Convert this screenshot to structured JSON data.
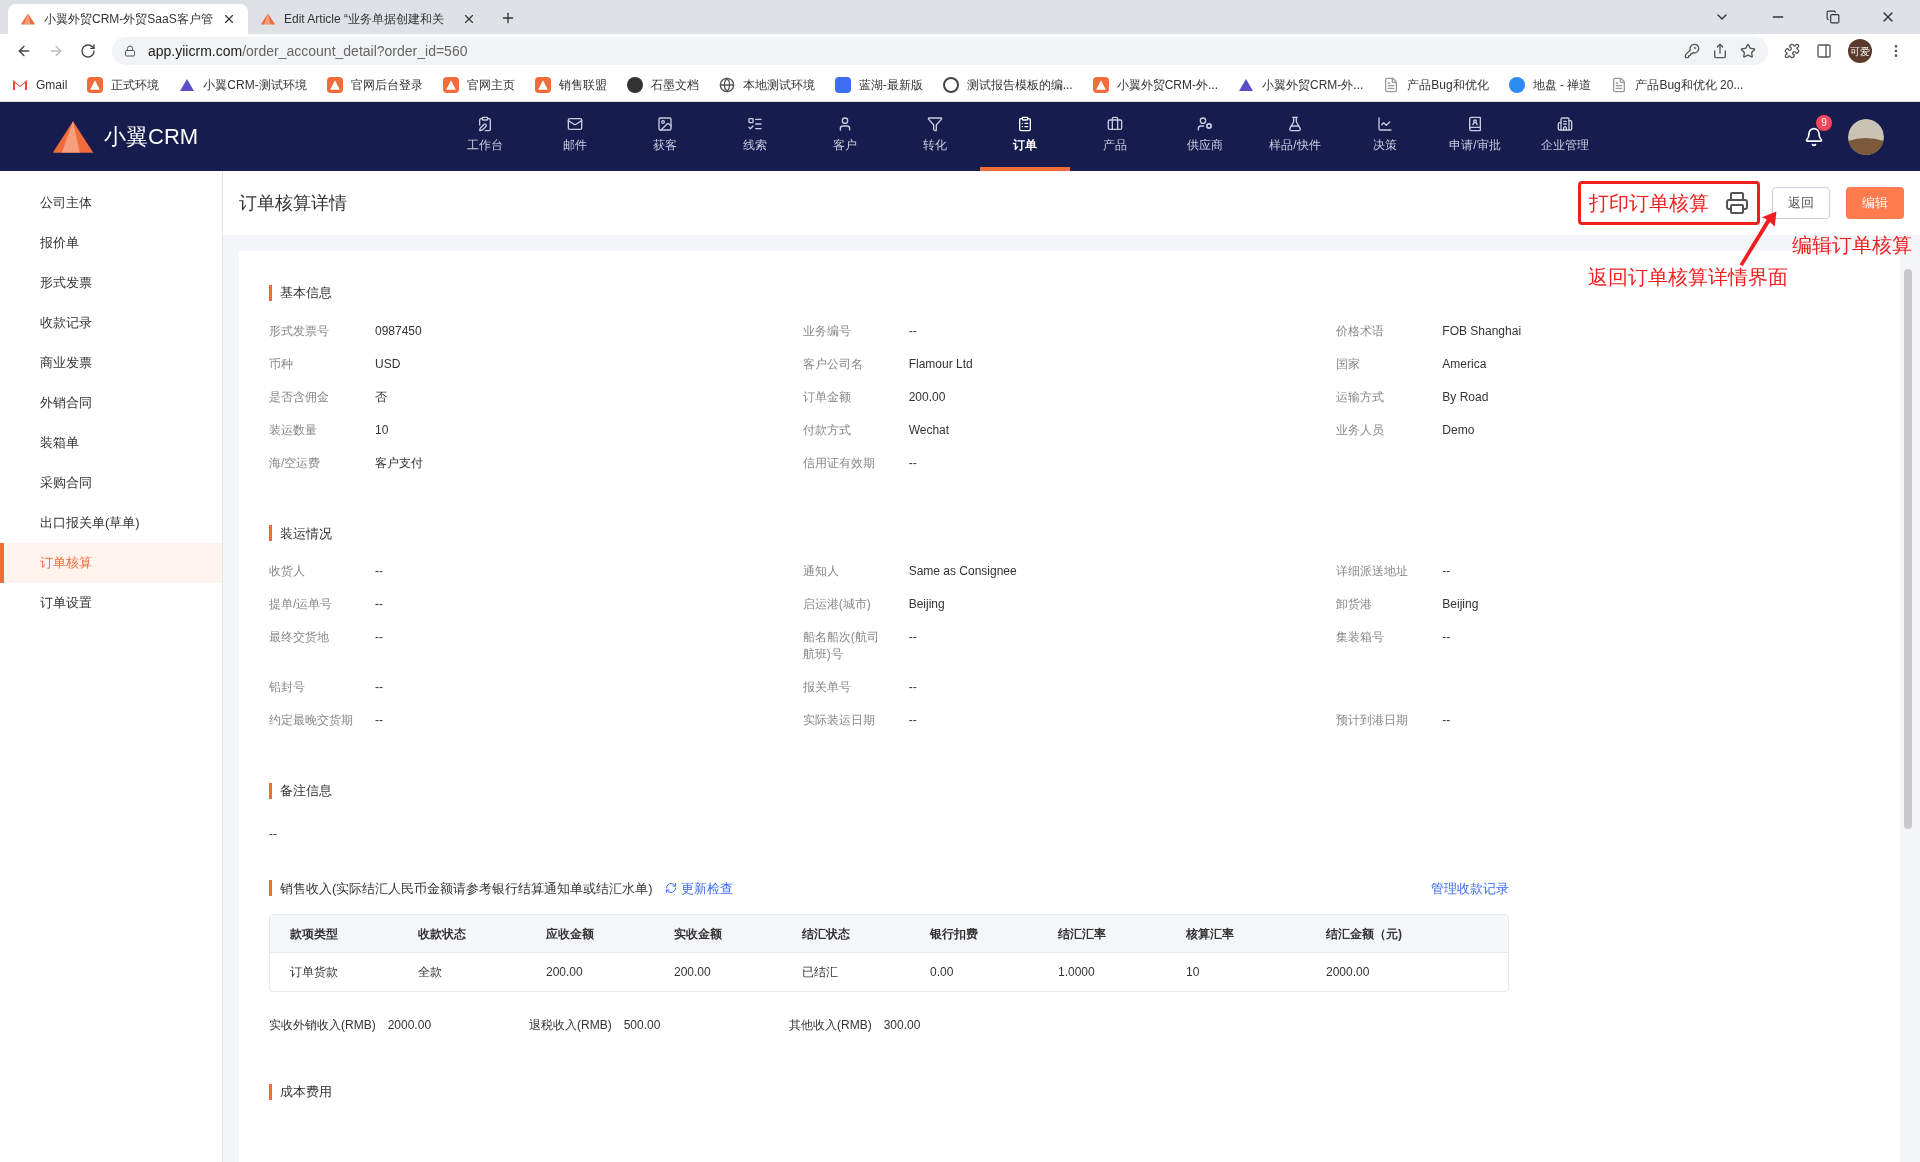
{
  "browser": {
    "tabs": [
      {
        "title": "小翼外贸CRM-外贸SaaS客户管",
        "selected": true
      },
      {
        "title": "Edit Article “业务单据创建和关",
        "selected": false
      }
    ],
    "url_host": "app.yiicrm.com",
    "url_path": "/order_account_detail?order_id=560",
    "profile": "可爱",
    "bookmarks": [
      "Gmail",
      "正式环境",
      "小翼CRM-测试环境",
      "官网后台登录",
      "官网主页",
      "销售联盟",
      "石墨文档",
      "本地测试环境",
      "蓝湖-最新版",
      "测试报告模板的编...",
      "小翼外贸CRM-外...",
      "小翼外贸CRM-外...",
      "产品Bug和优化",
      "地盘 - 禅道",
      "产品Bug和优化 20..."
    ]
  },
  "app": {
    "logo": "小翼CRM",
    "notifications": "9",
    "nav": [
      {
        "label": "工作台",
        "selected": false
      },
      {
        "label": "邮件",
        "selected": false
      },
      {
        "label": "获客",
        "selected": false
      },
      {
        "label": "线索",
        "selected": false
      },
      {
        "label": "客户",
        "selected": false
      },
      {
        "label": "转化",
        "selected": false
      },
      {
        "label": "订单",
        "selected": true
      },
      {
        "label": "产品",
        "selected": false
      },
      {
        "label": "供应商",
        "selected": false
      },
      {
        "label": "样品/快件",
        "selected": false
      },
      {
        "label": "决策",
        "selected": false
      },
      {
        "label": "申请/审批",
        "selected": false
      },
      {
        "label": "企业管理",
        "selected": false
      }
    ]
  },
  "sidebar": {
    "items": [
      {
        "label": "公司主体",
        "selected": false
      },
      {
        "label": "报价单",
        "selected": false
      },
      {
        "label": "形式发票",
        "selected": false
      },
      {
        "label": "收款记录",
        "selected": false
      },
      {
        "label": "商业发票",
        "selected": false
      },
      {
        "label": "外销合同",
        "selected": false
      },
      {
        "label": "装箱单",
        "selected": false
      },
      {
        "label": "采购合同",
        "selected": false
      },
      {
        "label": "出口报关单(草单)",
        "selected": false
      },
      {
        "label": "订单核算",
        "selected": true
      },
      {
        "label": "订单设置",
        "selected": false
      }
    ]
  },
  "header": {
    "title": "订单核算详情",
    "buttons": [
      {
        "label": "返回",
        "kind": "outline"
      },
      {
        "label": "编辑",
        "kind": "primary"
      }
    ]
  },
  "annotations": {
    "print_label": "打印订单核算",
    "edit_note": "编辑订单核算",
    "back_note": "返回订单核算详情界面"
  },
  "basic_info": {
    "title": "基本信息",
    "rows": [
      [
        {
          "label": "形式发票号",
          "value": "0987450"
        },
        {
          "label": "业务编号",
          "value": "--"
        },
        {
          "label": "价格术语",
          "value": "FOB Shanghai"
        }
      ],
      [
        {
          "label": "币种",
          "value": "USD"
        },
        {
          "label": "客户公司名",
          "value": "Flamour Ltd"
        },
        {
          "label": "国家",
          "value": "America"
        }
      ],
      [
        {
          "label": "是否含佣金",
          "value": "否"
        },
        {
          "label": "订单金额",
          "value": "200.00"
        },
        {
          "label": "运输方式",
          "value": "By Road"
        }
      ],
      [
        {
          "label": "装运数量",
          "value": "10"
        },
        {
          "label": "付款方式",
          "value": "Wechat"
        },
        {
          "label": "业务人员",
          "value": "Demo"
        }
      ],
      [
        {
          "label": "海/空运费",
          "value": "客户支付"
        },
        {
          "label": "信用证有效期",
          "value": "--"
        }
      ]
    ]
  },
  "shipping": {
    "title": "装运情况",
    "rows": [
      [
        {
          "label": "收货人",
          "value": "--"
        },
        {
          "label": "通知人",
          "value": "Same as Consignee"
        },
        {
          "label": "详细派送地址",
          "value": "--"
        }
      ],
      [
        {
          "label": "提单/运单号",
          "value": "--"
        },
        {
          "label": "启运港(城市)",
          "value": "Beijing"
        },
        {
          "label": "卸货港",
          "value": "Beijing"
        }
      ],
      [
        {
          "label": "最终交货地",
          "value": "--"
        },
        {
          "label": "船名船次(航司航班)号",
          "value": "--"
        },
        {
          "label": "集装箱号",
          "value": "--"
        }
      ],
      [
        {
          "label": "铅封号",
          "value": "--"
        },
        {
          "label": "报关单号",
          "value": "--"
        }
      ],
      [
        {
          "label": "约定最晚交货期",
          "value": "--"
        },
        {
          "label": "实际装运日期",
          "value": "--"
        },
        {
          "label": "预计到港日期",
          "value": "--"
        }
      ]
    ]
  },
  "notes": {
    "title": "备注信息",
    "value": "--"
  },
  "sales_income": {
    "title": "销售收入(实际结汇人民币金额请参考银行结算通知单或结汇水单)",
    "refresh_link": "更新检查",
    "manage_link": "管理收款记录",
    "table": {
      "columns": [
        "款项类型",
        "收款状态",
        "应收金额",
        "实收金额",
        "结汇状态",
        "银行扣费",
        "结汇汇率",
        "核算汇率",
        "结汇金额（元)"
      ],
      "rows": [
        [
          "订单货款",
          "全款",
          "200.00",
          "200.00",
          "已结汇",
          "0.00",
          "1.0000",
          "10",
          "2000.00"
        ]
      ]
    },
    "totals": [
      {
        "label": "实收外销收入(RMB)",
        "value": "2000.00"
      },
      {
        "label": "退税收入(RMB)",
        "value": "500.00"
      },
      {
        "label": "其他收入(RMB)",
        "value": "300.00"
      }
    ]
  },
  "cost": {
    "title": "成本费用"
  }
}
